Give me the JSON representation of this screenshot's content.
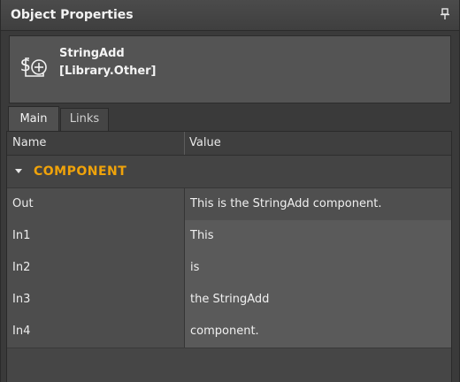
{
  "panel": {
    "title": "Object Properties"
  },
  "component": {
    "name": "StringAdd",
    "library": "[Library.Other]",
    "icon": "string-add-icon"
  },
  "tabs": [
    {
      "label": "Main",
      "active": true
    },
    {
      "label": "Links",
      "active": false
    }
  ],
  "grid": {
    "columns": [
      "Name",
      "Value"
    ],
    "category": "COMPONENT",
    "rows": [
      {
        "name": "Out",
        "value": "This is the StringAdd component."
      },
      {
        "name": "In1",
        "value": "This"
      },
      {
        "name": "In2",
        "value": "is"
      },
      {
        "name": "In3",
        "value": "the StringAdd"
      },
      {
        "name": "In4",
        "value": "component."
      }
    ]
  },
  "colors": {
    "accent": "#f0a30a",
    "background": "#3a3a3a"
  }
}
